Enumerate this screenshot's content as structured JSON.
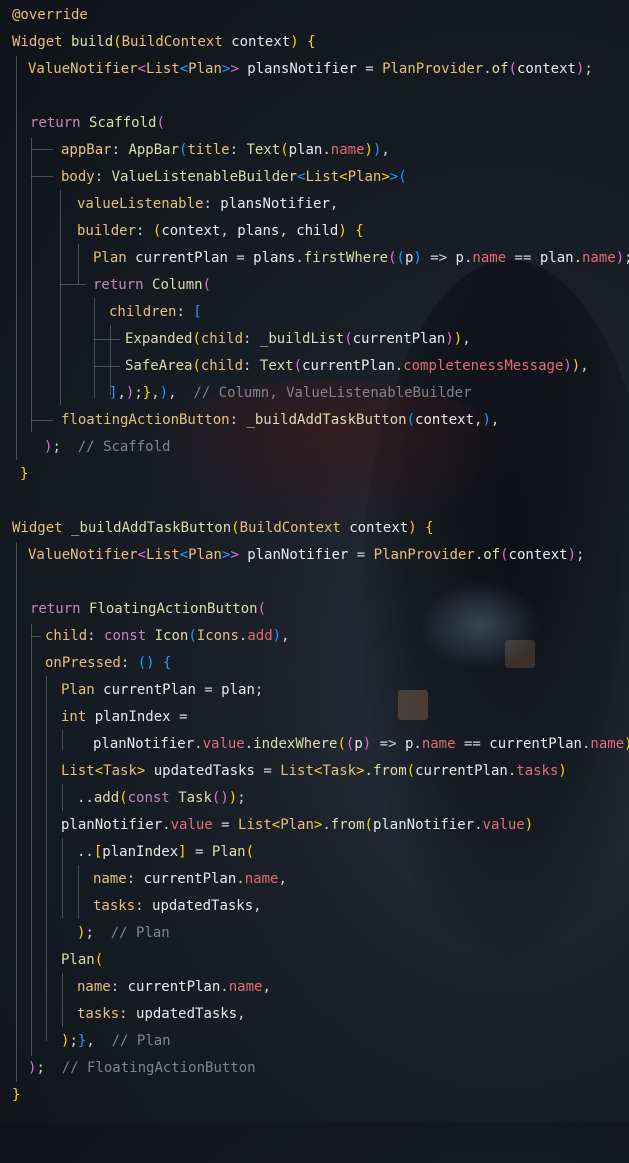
{
  "code": {
    "lines": [
      "@override",
      "Widget build(BuildContext context) {",
      "  ValueNotifier<List<Plan>> plansNotifier = PlanProvider.of(context);",
      "",
      "  return Scaffold(",
      "    appBar: AppBar(title: Text(plan.name)),",
      "    body: ValueListenableBuilder<List<Plan>>(",
      "      valueListenable: plansNotifier,",
      "      builder: (context, plans, child) {",
      "        Plan currentPlan = plans.firstWhere((p) => p.name == plan.name);",
      "        return Column(",
      "          children: [",
      "            Expanded(child: _buildList(currentPlan)),",
      "            SafeArea(child: Text(currentPlan.completenessMessage)),",
      "          ],);},),  // Column, ValueListenableBuilder",
      "    floatingActionButton: _buildAddTaskButton(context,),",
      "  );  // Scaffold",
      "}",
      "",
      "Widget _buildAddTaskButton(BuildContext context) {",
      "  ValueNotifier<List<Plan>> planNotifier = PlanProvider.of(context);",
      "",
      "  return FloatingActionButton(",
      "    child: const Icon(Icons.add),",
      "    onPressed: () {",
      "      Plan currentPlan = plan;",
      "      int planIndex =",
      "          planNotifier.value.indexWhere((p) => p.name == currentPlan.name);",
      "      List<Task> updatedTasks = List<Task>.from(currentPlan.tasks)",
      "        ..add(const Task());",
      "      planNotifier.value = List<Plan>.from(planNotifier.value)",
      "        ..[planIndex] = Plan(",
      "          name: currentPlan.name,",
      "          tasks: updatedTasks,",
      "        );  // Plan",
      "      Plan(",
      "        name: currentPlan.name,",
      "        tasks: updatedTasks,",
      "      );},  // Plan",
      "  );  // FloatingActionButton",
      "}"
    ]
  },
  "colors": {
    "keyword": "#c586c0",
    "type": "#e5c07b",
    "function": "#dcdcaa",
    "property": "#e06c75",
    "comment": "#7f848e",
    "text": "#d4d4d4"
  }
}
